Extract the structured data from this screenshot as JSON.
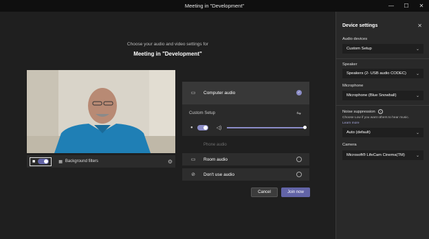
{
  "window": {
    "title": "Meeting in \"Development\"",
    "minimize": "—",
    "maximize": "☐",
    "close": "✕"
  },
  "prejoin": {
    "prompt": "Choose your audio and video settings for",
    "meeting_title": "Meeting in \"Development\""
  },
  "video": {
    "camera_on": true,
    "background_filters_label": "Background filters"
  },
  "audio_options": {
    "computer_audio": "Computer audio",
    "custom_setup": "Custom Setup",
    "mic_on": true,
    "speaker_volume": 1.0,
    "phone_audio": "Phone audio",
    "room_audio": "Room audio",
    "dont_use_audio": "Don't use audio",
    "selected": "computer_audio"
  },
  "actions": {
    "cancel": "Cancel",
    "join": "Join now"
  },
  "device_settings": {
    "title": "Device settings",
    "audio_devices_label": "Audio devices",
    "audio_devices_value": "Custom Setup",
    "speaker_label": "Speaker",
    "speaker_value": "Speakers (2- USB audio CODEC)",
    "microphone_label": "Microphone",
    "microphone_value": "Microphone (Blue Snowball)",
    "noise_label": "Noise suppression",
    "noise_hint": "Choose Low if you want others to hear music.",
    "learn_more": "Learn more",
    "noise_value": "Auto (default)",
    "camera_label": "Camera",
    "camera_value": "Microsoft® LifeCam Cinema(TM)"
  },
  "colors": {
    "accent": "#6264a7",
    "accent_light": "#8b8cc7",
    "background": "#1f1f1f",
    "panel": "#292929"
  }
}
